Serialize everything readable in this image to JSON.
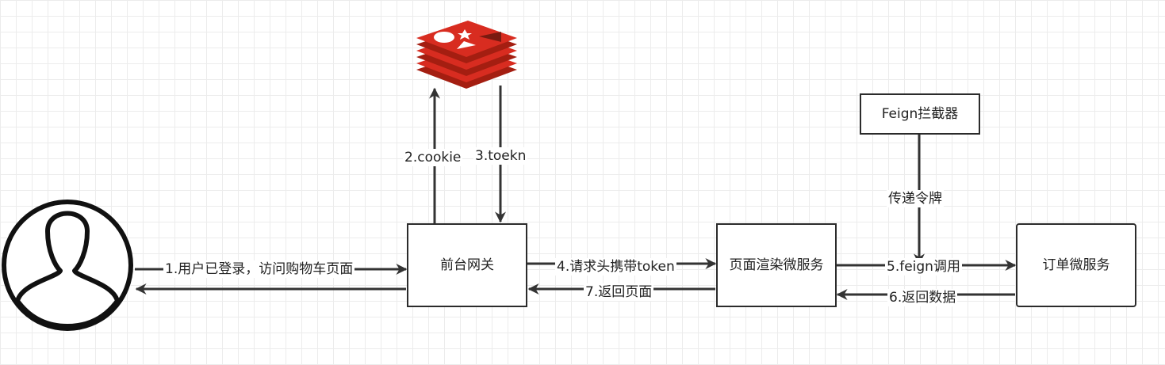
{
  "nodes": {
    "gateway": "前台网关",
    "render_service": "页面渲染微服务",
    "order_service": "订单微服务",
    "feign_interceptor": "Feign拦截器"
  },
  "edges": {
    "step1": "1.用户已登录，访问购物车页面",
    "step2": "2.cookie",
    "step3": "3.toekn",
    "step4": "4.请求头携带token",
    "step5": "5.feign调用",
    "step6": "6.返回数据",
    "step7": "7.返回页面",
    "pass_token": "传递令牌"
  },
  "icons": {
    "user": "user-avatar-icon",
    "redis": "redis-logo-icon"
  },
  "colors": {
    "line": "#333333",
    "redis_red": "#d82c20",
    "redis_dark": "#a41e11"
  }
}
